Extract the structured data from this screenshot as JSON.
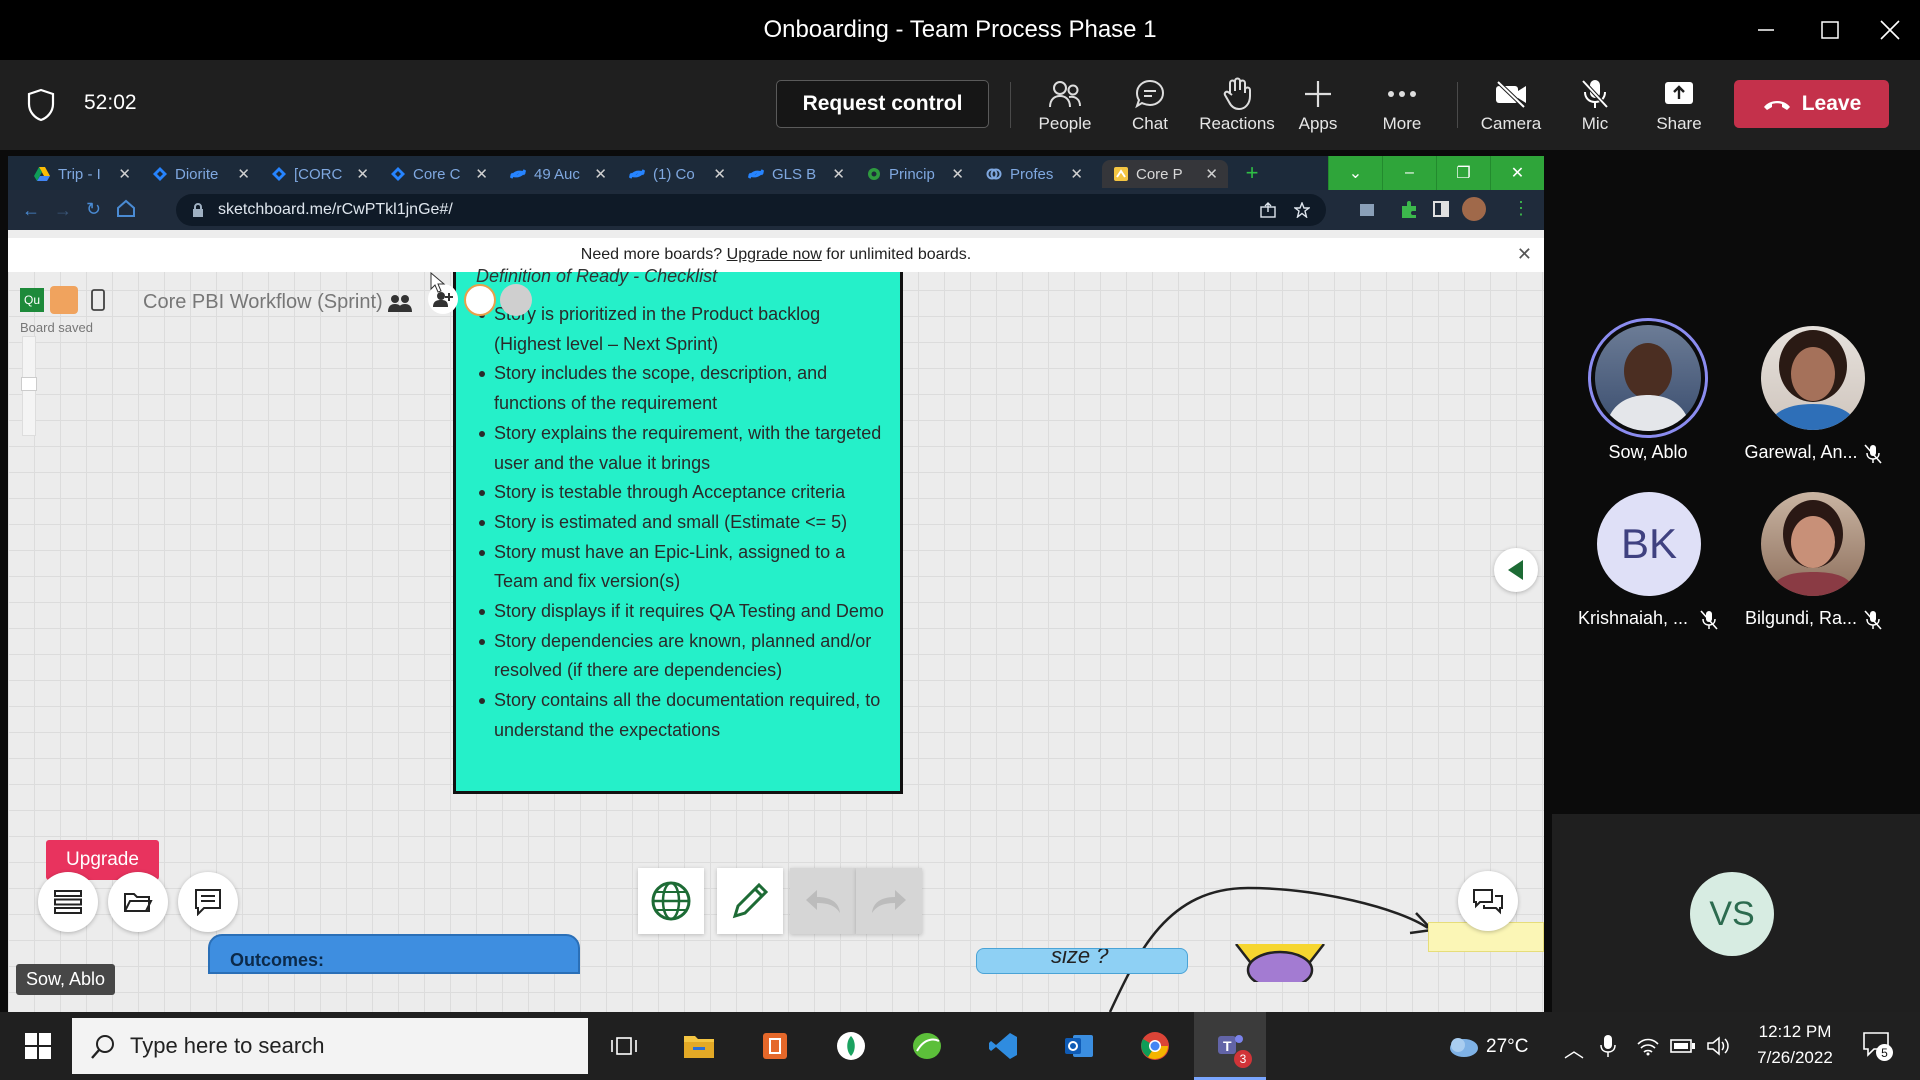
{
  "window": {
    "title": "Onboarding - Team Process Phase 1"
  },
  "toolbar": {
    "timer": "52:02",
    "request_control": "Request control",
    "items": [
      "People",
      "Chat",
      "Reactions",
      "Apps",
      "More"
    ],
    "media": [
      "Camera",
      "Mic",
      "Share"
    ],
    "leave": "Leave"
  },
  "browser": {
    "tabs": [
      {
        "label": "Trip - I",
        "icon": "drive-icon"
      },
      {
        "label": "Diorite",
        "icon": "jira-icon"
      },
      {
        "label": "[CORC",
        "icon": "jira-icon"
      },
      {
        "label": "Core C",
        "icon": "jira-icon"
      },
      {
        "label": "49 Auc",
        "icon": "confluence-icon"
      },
      {
        "label": "(1) Co",
        "icon": "confluence-icon"
      },
      {
        "label": "GLS B",
        "icon": "confluence-icon"
      },
      {
        "label": "Princip",
        "icon": "globe-icon"
      },
      {
        "label": "Profes",
        "icon": "link-icon"
      },
      {
        "label": "Core P",
        "icon": "sketchboard-icon"
      }
    ],
    "url": "sketchboard.me/rCwPTkl1jnGe#/"
  },
  "sketchboard": {
    "banner_prefix": "Need more boards?",
    "banner_link": "Upgrade now",
    "banner_suffix": "for unlimited boards.",
    "avatar_badge": "Qu",
    "board_title": "Core PBI Workflow (Sprint)",
    "board_saved": "Board saved",
    "card_title": "Definition of Ready - Checklist",
    "checklist": [
      "Story is prioritized in the Product backlog (Highest level – Next Sprint)",
      "Story includes the scope, description, and functions of the requirement",
      "Story explains the requirement, with the targeted user and the value it brings",
      "Story is testable through Acceptance criteria",
      "Story is estimated and small (Estimate <= 5)",
      "Story must have an Epic-Link, assigned to a Team and fix version(s)",
      "Story displays if it requires QA Testing and Demo",
      "Story dependencies are known, planned and/or resolved (if there are dependencies)",
      "Story contains all the documentation required, to understand the expectations"
    ],
    "upgrade": "Upgrade",
    "outcomes_label": "Outcomes:",
    "size_label": "size ?"
  },
  "presenter": "Sow, Ablo",
  "participants": [
    {
      "name": "Sow, Ablo",
      "initials": "",
      "muted": false
    },
    {
      "name": "Garewal, An...",
      "initials": "",
      "muted": true
    },
    {
      "name": "Krishnaiah, ...",
      "initials": "BK",
      "muted": true
    },
    {
      "name": "Bilgundi, Ra...",
      "initials": "",
      "muted": true
    }
  ],
  "vs_tile": {
    "initials": "VS"
  },
  "taskbar": {
    "search_placeholder": "Type here to search",
    "weather": "27°C",
    "time": "12:12 PM",
    "date": "7/26/2022",
    "teams_badge": "3",
    "notif_badge": "5"
  }
}
